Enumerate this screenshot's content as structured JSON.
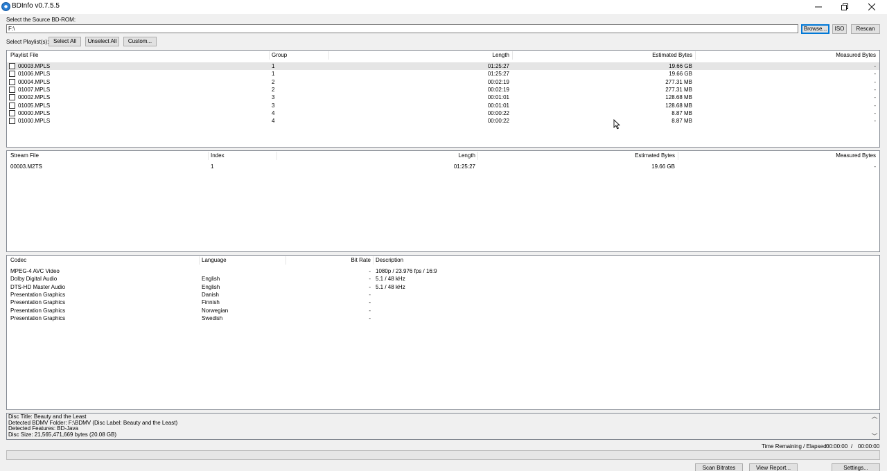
{
  "window": {
    "title": "BDInfo v0.7.5.5",
    "minimize_glyph": "—",
    "restore_glyph": "❐",
    "close_glyph": "✕"
  },
  "source": {
    "label": "Select the Source BD-ROM:",
    "value": "F:\\",
    "browse_label": "Browse...",
    "iso_label": "ISO",
    "rescan_label": "Rescan"
  },
  "playlist_controls": {
    "label": "Select Playlist(s):",
    "select_all_label": "Select All",
    "unselect_all_label": "Unselect All",
    "custom_label": "Custom..."
  },
  "playlists": {
    "headers": [
      "Playlist File",
      "Group",
      "Length",
      "Estimated Bytes",
      "Measured Bytes"
    ],
    "rows": [
      {
        "file": "00003.MPLS",
        "group": "1",
        "length": "01:25:27",
        "estimated": "19.66 GB",
        "measured": "-"
      },
      {
        "file": "01006.MPLS",
        "group": "1",
        "length": "01:25:27",
        "estimated": "19.66 GB",
        "measured": "-"
      },
      {
        "file": "00004.MPLS",
        "group": "2",
        "length": "00:02:19",
        "estimated": "277.31 MB",
        "measured": "-"
      },
      {
        "file": "01007.MPLS",
        "group": "2",
        "length": "00:02:19",
        "estimated": "277.31 MB",
        "measured": "-"
      },
      {
        "file": "00002.MPLS",
        "group": "3",
        "length": "00:01:01",
        "estimated": "128.68 MB",
        "measured": "-"
      },
      {
        "file": "01005.MPLS",
        "group": "3",
        "length": "00:01:01",
        "estimated": "128.68 MB",
        "measured": "-"
      },
      {
        "file": "00000.MPLS",
        "group": "4",
        "length": "00:00:22",
        "estimated": "8.87 MB",
        "measured": "-"
      },
      {
        "file": "01000.MPLS",
        "group": "4",
        "length": "00:00:22",
        "estimated": "8.87 MB",
        "measured": "-"
      }
    ]
  },
  "streams": {
    "headers": [
      "Stream File",
      "Index",
      "Length",
      "Estimated Bytes",
      "Measured Bytes"
    ],
    "rows": [
      {
        "file": "00003.M2TS",
        "index": "1",
        "length": "01:25:27",
        "estimated": "19.66 GB",
        "measured": "-"
      }
    ]
  },
  "codecs": {
    "headers": [
      "Codec",
      "Language",
      "Bit Rate",
      "Description"
    ],
    "rows": [
      {
        "codec": "MPEG-4 AVC Video",
        "language": "",
        "bitrate": "-",
        "description": "1080p / 23.976 fps / 16:9"
      },
      {
        "codec": "Dolby Digital Audio",
        "language": "English",
        "bitrate": "-",
        "description": "5.1 / 48 kHz"
      },
      {
        "codec": "DTS-HD Master Audio",
        "language": "English",
        "bitrate": "-",
        "description": "5.1 / 48 kHz"
      },
      {
        "codec": "Presentation Graphics",
        "language": "Danish",
        "bitrate": "-",
        "description": ""
      },
      {
        "codec": "Presentation Graphics",
        "language": "Finnish",
        "bitrate": "-",
        "description": ""
      },
      {
        "codec": "Presentation Graphics",
        "language": "Norwegian",
        "bitrate": "-",
        "description": ""
      },
      {
        "codec": "Presentation Graphics",
        "language": "Swedish",
        "bitrate": "-",
        "description": ""
      }
    ]
  },
  "log": {
    "lines": [
      "Disc Title: Beauty and the Least",
      "Detected BDMV Folder: F:\\BDMV (Disc Label: Beauty and the Least)",
      "Detected Features: BD-Java",
      "Disc Size: 21,565,471,669 bytes (20.08 GB)"
    ],
    "scroll_up": "︿",
    "scroll_down": "﹀"
  },
  "timing": {
    "label": "Time Remaining / Elapsed:",
    "remaining": "00:00:00",
    "separator": "/",
    "elapsed": "00:00:00"
  },
  "progress": {
    "fraction": 0
  },
  "footer": {
    "scan_label": "Scan Bitrates",
    "report_label": "View Report...",
    "settings_label": "Settings..."
  }
}
